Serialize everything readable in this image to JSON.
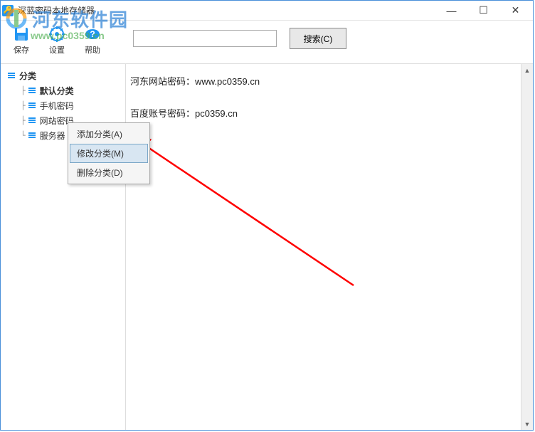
{
  "window": {
    "title": "深蓝密码本地存储器",
    "minimize": "—",
    "maximize": "☐",
    "close": "✕"
  },
  "toolbar": {
    "save_label": "保存",
    "settings_label": "设置",
    "help_label": "帮助"
  },
  "search": {
    "placeholder": "",
    "value": "",
    "button_label": "搜索(C)"
  },
  "sidebar": {
    "root": "分类",
    "items": [
      {
        "label": "默认分类"
      },
      {
        "label": "手机密码"
      },
      {
        "label": "网站密码"
      },
      {
        "label": "服务器"
      }
    ]
  },
  "content": {
    "line1": "河东网站密码：www.pc0359.cn",
    "line2": "百度账号密码：pc0359.cn"
  },
  "context_menu": {
    "add": "添加分类(A)",
    "modify": "修改分类(M)",
    "delete": "删除分类(D)"
  },
  "watermark": {
    "text": "河东软件园",
    "url": "www.pc0359.cn"
  }
}
